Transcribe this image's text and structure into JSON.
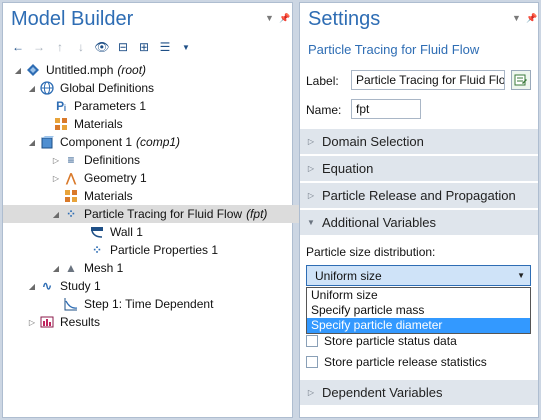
{
  "model_builder": {
    "title": "Model Builder",
    "tree": [
      {
        "label": "Untitled.mph",
        "tag": "(root)",
        "icon": "model-icon"
      },
      {
        "label": "Global Definitions",
        "icon": "globe-icon"
      },
      {
        "label": "Parameters 1",
        "icon": "parameters-icon",
        "glyph": "Pᵢ"
      },
      {
        "label": "Materials",
        "icon": "materials-icon"
      },
      {
        "label": "Component 1",
        "tag": "(comp1)",
        "icon": "component-icon"
      },
      {
        "label": "Definitions",
        "icon": "definitions-icon",
        "glyph": "≡"
      },
      {
        "label": "Geometry 1",
        "icon": "geometry-icon",
        "glyph": "⋀"
      },
      {
        "label": "Materials",
        "icon": "materials-icon"
      },
      {
        "label": "Particle Tracing for Fluid Flow",
        "tag": "(fpt)",
        "icon": "particle-tracing-icon",
        "glyph": "⁘"
      },
      {
        "label": "Wall 1",
        "icon": "wall-icon"
      },
      {
        "label": "Particle Properties 1",
        "icon": "particle-properties-icon",
        "glyph": "⁘"
      },
      {
        "label": "Mesh 1",
        "icon": "mesh-icon",
        "glyph": "▲"
      },
      {
        "label": "Study 1",
        "icon": "study-icon",
        "glyph": "∿"
      },
      {
        "label": "Step 1: Time Dependent",
        "icon": "time-dependent-icon",
        "glyph": "⌇"
      },
      {
        "label": "Results",
        "icon": "results-icon"
      }
    ]
  },
  "settings": {
    "title": "Settings",
    "subtitle": "Particle Tracing for Fluid Flow",
    "label_caption": "Label:",
    "label_value": "Particle Tracing for Fluid Flo",
    "name_caption": "Name:",
    "name_value": "fpt",
    "sections": [
      "Domain Selection",
      "Equation",
      "Particle Release and Propagation",
      "Additional Variables"
    ],
    "psd_label": "Particle size distribution:",
    "combo_value": "Uniform size",
    "options": [
      "Uniform size",
      "Specify particle mass",
      "Specify particle diameter"
    ],
    "checkboxes": [
      "Store particle status data",
      "Store particle release statistics"
    ],
    "bottom_section": "Dependent Variables"
  },
  "colors": {
    "accent": "#2e6db4",
    "selection": "#3399ff",
    "section_bg": "#dfe5ec"
  }
}
